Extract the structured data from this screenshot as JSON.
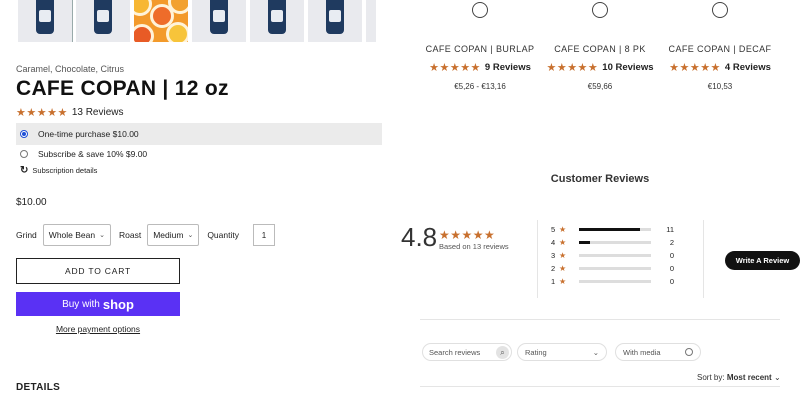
{
  "product": {
    "flavors": "Caramel, Chocolate, Citrus",
    "title": "CAFE COPAN | 12 oz",
    "stars": "★★★★★",
    "review_count": "13 Reviews",
    "rating_value": 5
  },
  "purchase_options": [
    {
      "label": "One-time purchase $10.00",
      "selected": true
    },
    {
      "label": "Subscribe & save 10% $9.00",
      "selected": false
    }
  ],
  "subscription_details": "Subscription details",
  "price": "$10.00",
  "selectors": {
    "grind_label": "Grind",
    "grind_value": "Whole Bean",
    "roast_label": "Roast",
    "roast_value": "Medium",
    "quantity_label": "Quantity",
    "quantity_value": "1"
  },
  "buttons": {
    "add_to_cart": "ADD TO CART",
    "buy_with": "Buy with",
    "shop": "shop",
    "more_payment": "More payment options",
    "write_review": "Write A Review"
  },
  "details_heading": "DETAILS",
  "related": [
    {
      "name": "CAFE COPAN | BURLAP",
      "stars": "★★★★★",
      "reviews": "9 Reviews",
      "price": "€5,26 - €13,16"
    },
    {
      "name": "CAFE COPAN | 8 PK",
      "stars": "★★★★★",
      "reviews": "10 Reviews",
      "price": "€59,66"
    },
    {
      "name": "CAFE COPAN | DECAF",
      "stars": "★★★★★",
      "reviews": "4 Reviews",
      "price": "€10,53"
    }
  ],
  "reviews_summary": {
    "title": "Customer Reviews",
    "average": "4.8",
    "stars": "★★★★★",
    "based_on": "Based on 13 reviews",
    "breakdown": [
      {
        "star": "5",
        "count": "11",
        "fraction": 0.85
      },
      {
        "star": "4",
        "count": "2",
        "fraction": 0.15
      },
      {
        "star": "3",
        "count": "0",
        "fraction": 0
      },
      {
        "star": "2",
        "count": "0",
        "fraction": 0
      },
      {
        "star": "1",
        "count": "0",
        "fraction": 0
      }
    ]
  },
  "filters": {
    "search_placeholder": "Search reviews",
    "rating_label": "Rating",
    "with_media": "With media",
    "sort_label": "Sort by:",
    "sort_value": "Most recent"
  },
  "colors": {
    "star": "#c8702e",
    "shop_button": "#5a31f4",
    "radio_selected": "#1f4fd6"
  }
}
